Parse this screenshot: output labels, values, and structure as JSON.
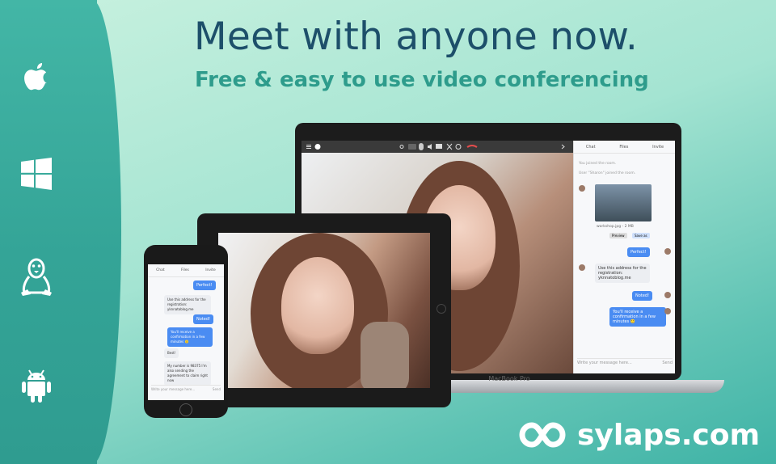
{
  "hero": {
    "headline": "Meet with anyone now.",
    "subheadline": "Free & easy to use video conferencing"
  },
  "brand": {
    "domain": "sylaps.com"
  },
  "platforms": [
    "apple-icon",
    "windows-icon",
    "linux-icon",
    "android-icon"
  ],
  "laptop": {
    "label": "MacBook Pro",
    "chat": {
      "tabs": [
        "Chat",
        "Files",
        "Invite"
      ],
      "system": [
        "You joined the room.",
        "User \"Sharon\" joined the room."
      ],
      "file_name": "workshop.jpg - 2 MB",
      "file_preview": "Preview",
      "file_save": "Save as",
      "messages": [
        {
          "dir": "out",
          "text": "Perfect!"
        },
        {
          "dir": "in",
          "text": "Use this address for the registration: yknnatoblog.me"
        },
        {
          "dir": "out",
          "text": "Noted!"
        },
        {
          "dir": "out",
          "text": "You'll receive a confirmation in a few minutes 🙂"
        }
      ],
      "input_placeholder": "Write your message here...",
      "send": "Send"
    }
  },
  "phone": {
    "chat": {
      "tabs": [
        "Chat",
        "Files",
        "Invite"
      ],
      "messages": [
        {
          "dir": "out",
          "text": "Perfect!"
        },
        {
          "dir": "in",
          "text": "Use this address for the registration: yknnatoblog.me"
        },
        {
          "dir": "out",
          "text": "Noted!"
        },
        {
          "dir": "out",
          "text": "You'll receive a confirmation in a few minutes 🙂"
        },
        {
          "dir": "in",
          "text": "Best!"
        },
        {
          "dir": "in",
          "text": "My number is 98375 I'm also sending the agreement to claim right now"
        }
      ],
      "input_placeholder": "Write your message here...",
      "send": "Send"
    }
  },
  "colors": {
    "accent": "#4a8cf2",
    "headline": "#1d4f6a",
    "subheadline": "#2e9c8c",
    "sidebar": "#3aa99b"
  }
}
